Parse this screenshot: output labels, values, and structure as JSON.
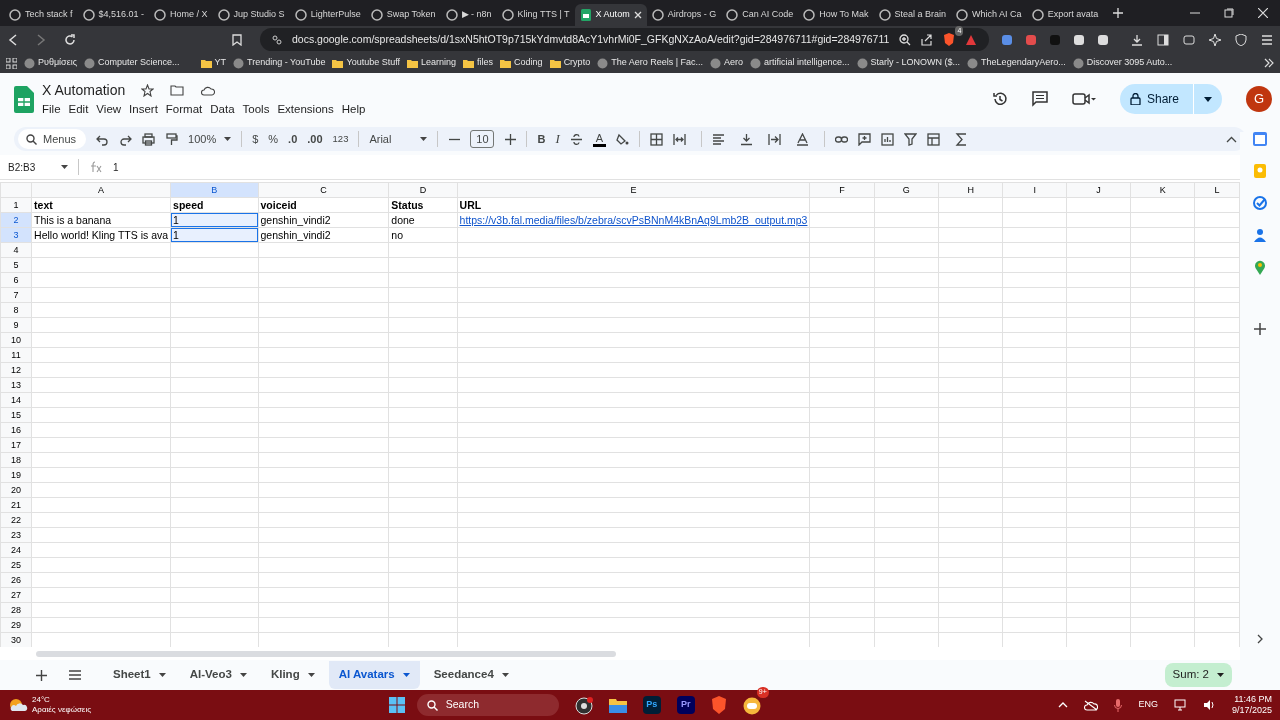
{
  "browser": {
    "tabs": [
      {
        "title": "Tech stack f",
        "selected": false
      },
      {
        "title": "$4,516.01 -",
        "selected": false
      },
      {
        "title": "Home / X",
        "selected": false
      },
      {
        "title": "Jup Studio S",
        "selected": false
      },
      {
        "title": "LighterPulse",
        "selected": false
      },
      {
        "title": "Swap Token",
        "selected": false
      },
      {
        "title": "▶ - n8n",
        "selected": false
      },
      {
        "title": "Kling TTS | T",
        "selected": false
      },
      {
        "title": "X Autom",
        "selected": true
      },
      {
        "title": "Airdrops - G",
        "selected": false
      },
      {
        "title": "Can AI Code",
        "selected": false
      },
      {
        "title": "How To Mak",
        "selected": false
      },
      {
        "title": "Steal a Brain",
        "selected": false
      },
      {
        "title": "Which AI Ca",
        "selected": false
      },
      {
        "title": "Export avata",
        "selected": false
      }
    ],
    "url": "docs.google.com/spreadsheets/d/1sxN5htOT9p715kYdmvtd8AcY1vhrMi0F_GFKgNXzAoA/edit?gid=284976711#gid=284976711",
    "extension_badge": "4",
    "bookmarks": [
      {
        "label": "Ρυθμίσεις",
        "kind": "site"
      },
      {
        "label": "Computer Science...",
        "kind": "site"
      },
      {
        "label": "YT",
        "kind": "folder"
      },
      {
        "label": "Trending - YouTube",
        "kind": "site"
      },
      {
        "label": "Youtube Stuff",
        "kind": "folder"
      },
      {
        "label": "Learning",
        "kind": "folder"
      },
      {
        "label": "files",
        "kind": "folder"
      },
      {
        "label": "Coding",
        "kind": "folder"
      },
      {
        "label": "Crypto",
        "kind": "folder"
      },
      {
        "label": "The Aero Reels | Fac...",
        "kind": "site"
      },
      {
        "label": "Aero",
        "kind": "site"
      },
      {
        "label": "artificial intelligence...",
        "kind": "site"
      },
      {
        "label": "Starly - LONOWN ($...",
        "kind": "site"
      },
      {
        "label": "TheLegendaryAero...",
        "kind": "site"
      },
      {
        "label": "Discover 3095 Auto...",
        "kind": "site"
      }
    ]
  },
  "sheets": {
    "title": "X Automation",
    "menu": [
      "File",
      "Edit",
      "View",
      "Insert",
      "Format",
      "Data",
      "Tools",
      "Extensions",
      "Help"
    ],
    "share": "Share",
    "avatar": "G",
    "toolbar": {
      "search": "Menus",
      "zoom": "100%",
      "currency": "$",
      "percent": "%",
      "decimal_less": ".0",
      "decimal_more": ".00",
      "number_format": "123",
      "font": "Arial",
      "font_size": "10",
      "bold": "B",
      "italic": "I",
      "text_color": "A"
    },
    "name_box": "B2:B3",
    "formula": "1",
    "columns": [
      {
        "label": "A",
        "selected": false
      },
      {
        "label": "B",
        "selected": true
      },
      {
        "label": "C",
        "selected": false
      },
      {
        "label": "D",
        "selected": false
      },
      {
        "label": "E",
        "selected": false
      },
      {
        "label": "F",
        "selected": false
      },
      {
        "label": "G",
        "selected": false
      },
      {
        "label": "H",
        "selected": false
      },
      {
        "label": "I",
        "selected": false
      },
      {
        "label": "J",
        "selected": false
      },
      {
        "label": "K",
        "selected": false
      },
      {
        "label": "L",
        "selected": false
      }
    ],
    "rows": [
      {
        "label": "1",
        "selected": false,
        "bold": true,
        "cells": [
          {
            "text": "text"
          },
          {
            "text": "speed"
          },
          {
            "text": "voiceid"
          },
          {
            "text": "Status"
          },
          {
            "text": "URL"
          }
        ]
      },
      {
        "label": "2",
        "selected": true,
        "bold": false,
        "cells": [
          {
            "text": "This is a banana"
          },
          {
            "text": "1",
            "selected": true
          },
          {
            "text": "genshin_vindi2"
          },
          {
            "text": "done"
          },
          {
            "text": "https://v3b.fal.media/files/b/zebra/scvPsBNnM4kBnAq9Lmb2B_output.mp3",
            "kind": "link"
          }
        ]
      },
      {
        "label": "3",
        "selected": true,
        "bold": false,
        "cells": [
          {
            "text": "Hello world! Kling TTS is ava"
          },
          {
            "text": "1",
            "selected": true
          },
          {
            "text": "genshin_vindi2"
          },
          {
            "text": "no"
          }
        ]
      },
      {
        "label": "4",
        "selected": false
      },
      {
        "label": "5",
        "selected": false
      },
      {
        "label": "6",
        "selected": false
      },
      {
        "label": "7",
        "selected": false
      },
      {
        "label": "8",
        "selected": false
      },
      {
        "label": "9",
        "selected": false
      },
      {
        "label": "10",
        "selected": false
      },
      {
        "label": "11",
        "selected": false
      },
      {
        "label": "12",
        "selected": false
      },
      {
        "label": "13",
        "selected": false
      },
      {
        "label": "14",
        "selected": false
      },
      {
        "label": "15",
        "selected": false
      },
      {
        "label": "16",
        "selected": false
      },
      {
        "label": "17",
        "selected": false
      },
      {
        "label": "18",
        "selected": false
      },
      {
        "label": "19",
        "selected": false
      },
      {
        "label": "20",
        "selected": false
      },
      {
        "label": "21",
        "selected": false
      },
      {
        "label": "22",
        "selected": false
      },
      {
        "label": "23",
        "selected": false
      },
      {
        "label": "24",
        "selected": false
      },
      {
        "label": "25",
        "selected": false
      },
      {
        "label": "26",
        "selected": false
      },
      {
        "label": "27",
        "selected": false
      },
      {
        "label": "28",
        "selected": false
      },
      {
        "label": "29",
        "selected": false
      },
      {
        "label": "30",
        "selected": false
      }
    ],
    "sheet_tabs": [
      {
        "label": "Sheet1",
        "selected": false
      },
      {
        "label": "AI-Veo3",
        "selected": false
      },
      {
        "label": "Kling",
        "selected": false
      },
      {
        "label": "AI Avatars",
        "selected": true
      },
      {
        "label": "Seedance4",
        "selected": false
      }
    ],
    "sum": "Sum: 2"
  },
  "taskbar": {
    "temperature": "24°C",
    "weather": "Αραιές νεφώσεις",
    "search": "Search",
    "apps": [
      {
        "label": "Ps"
      },
      {
        "label": "Pr"
      }
    ],
    "chat_badge": "9+",
    "language": "ENG",
    "time": "11:46 PM",
    "date": "9/17/2025"
  }
}
